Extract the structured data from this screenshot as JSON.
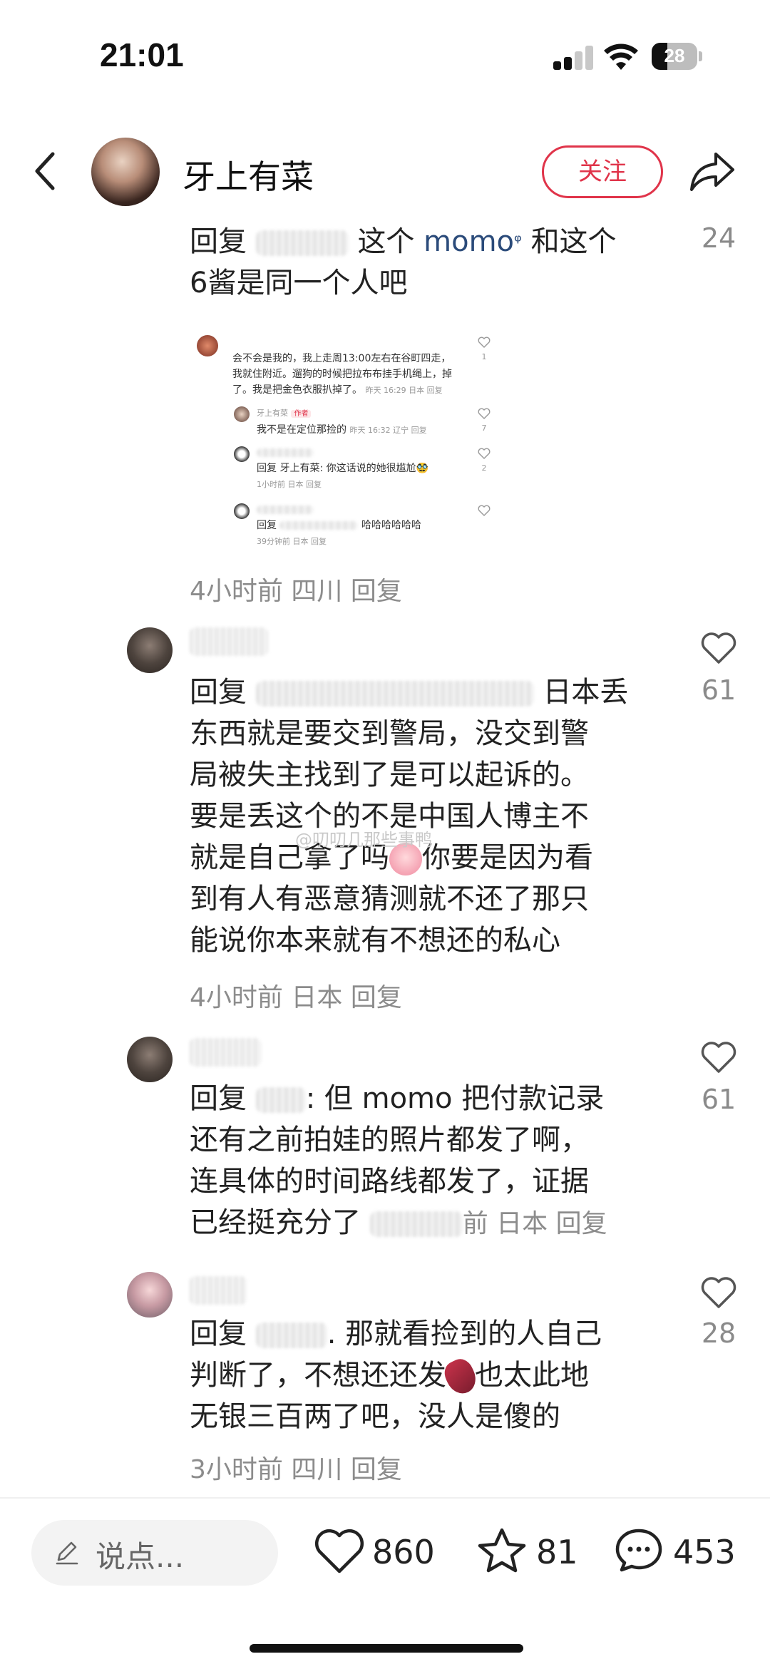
{
  "status_bar": {
    "time": "21:01",
    "battery": "28"
  },
  "header": {
    "author": "牙上有菜",
    "follow_label": "关注"
  },
  "comments": [
    {
      "reply_prefix": "回复",
      "text_a": "这个",
      "mention": "momo",
      "text_b": "和这个",
      "line2": "6酱是同一个人吧",
      "likes": "24",
      "meta_time": "4小时前",
      "meta_location": "四川",
      "meta_reply": "回复",
      "screenshot": {
        "c1_line1": "会不会是我的，我上走周13:00左右在谷町四走，",
        "c1_line2": "我就住附近。遛狗的时候把拉布布挂手机绳上，掉",
        "c1_line3": "了。我是把金色衣服扒掉了。",
        "c1_meta": "昨天 16:29 日本 回复",
        "c1_likes": "1",
        "c2_name": "牙上有菜",
        "c2_tag": "作者",
        "c2_text": "我不是在定位那捡的",
        "c2_meta": "昨天 16:32 辽宁 回复",
        "c2_likes": "7",
        "c3_text": "回复 牙上有菜: 你这话说的她很尴尬🥸",
        "c3_meta": "1小时前 日本 回复",
        "c3_likes": "2",
        "c4_prefix": "回复",
        "c4_text": "哈哈哈哈哈哈",
        "c4_meta": "39分钟前 日本 回复"
      }
    },
    {
      "reply_prefix": "回复",
      "line1_tail": "日本丢",
      "line2": "东西就是要交到警局，没交到警",
      "line3": "局被失主找到了是可以起诉的。",
      "line4": "要是丢这个的不是中国人博主不",
      "line5a": "就是自己拿了吗",
      "line5b": "你要是因为看",
      "line6": "到有人有恶意猜测就不还了那只",
      "line7": "能说你本来就有不想还的私心",
      "likes": "61",
      "meta_time": "4小时前",
      "meta_location": "日本",
      "meta_reply": "回复"
    },
    {
      "reply_prefix": "回复",
      "line1_tail": ": 但 momo 把付款记录",
      "line2": "还有之前拍娃的照片都发了啊，",
      "line3": "连具体的时间路线都发了，证据",
      "line4": "已经挺充分了",
      "tail": "前 日本 回复",
      "likes": "61"
    },
    {
      "reply_prefix": "回复",
      "line1_tail": ". 那就看捡到的人自己",
      "line2a": "判断了，不想还还发",
      "line2b": "也太此地",
      "line3": "无银三百两了吧，没人是傻的",
      "likes": "28",
      "meta_time": "3小时前",
      "meta_location": "四川",
      "meta_reply": "回复"
    }
  ],
  "watermark": "@叨叨几那些事鸭",
  "bottom_bar": {
    "input_placeholder": "说点...",
    "likes": "860",
    "favorites": "81",
    "comments": "453"
  },
  "icons": [
    "back-icon",
    "share-icon",
    "heart-icon",
    "star-icon",
    "comment-icon",
    "pencil-icon"
  ],
  "colors": {
    "accent": "#e0344a",
    "mention": "#2b4b7a",
    "meta": "#8c8c8c"
  }
}
